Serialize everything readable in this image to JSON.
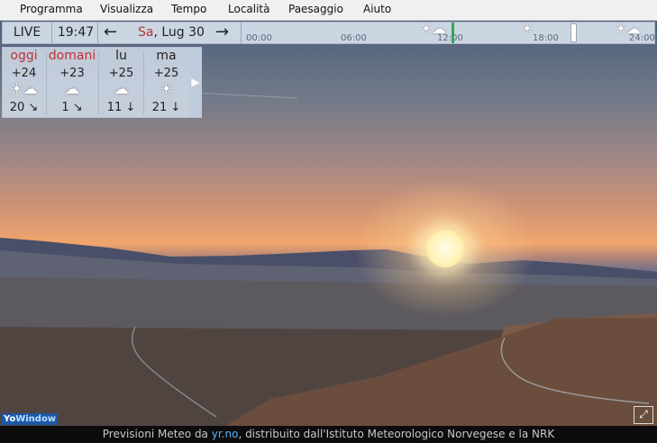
{
  "menu": [
    "Programma",
    "Visualizza",
    "Tempo",
    "Località",
    "Paesaggio",
    "Aiuto"
  ],
  "toolbar": {
    "live_label": "LIVE",
    "time": "19:47",
    "prev_arrow": "←",
    "next_arrow": "→",
    "date_day": "Sa",
    "date_rest": ", Lug 30"
  },
  "timeline": {
    "ticks": [
      "00:00",
      "06:00",
      "12:00",
      "18:00",
      "24:00"
    ],
    "icons": [
      "partly-cloudy-icon",
      "sun-icon",
      "partly-cloudy-icon"
    ]
  },
  "forecast": [
    {
      "day": "oggi",
      "temp": "+24",
      "icon": "partly-cloudy-icon",
      "wind": "20 ↘"
    },
    {
      "day": "domani",
      "temp": "+23",
      "icon": "rain-icon",
      "wind": "1 ↘"
    },
    {
      "day": "lu",
      "temp": "+25",
      "icon": "rain-icon",
      "wind": "11 ↓"
    },
    {
      "day": "ma",
      "temp": "+25",
      "icon": "sun-icon",
      "wind": "21 ↓"
    }
  ],
  "forecast_next": "▶",
  "status": {
    "prefix": "Previsioni Meteo da ",
    "link": "yr.no",
    "suffix": ", distribuito dall'Istituto Meteorologico Norvegese e la NRK"
  },
  "logo": {
    "main": "Yo",
    "sub": "Window"
  },
  "colors": {
    "accent_day": "#b33333",
    "now_marker": "#34a853",
    "link": "#57b2ff"
  }
}
